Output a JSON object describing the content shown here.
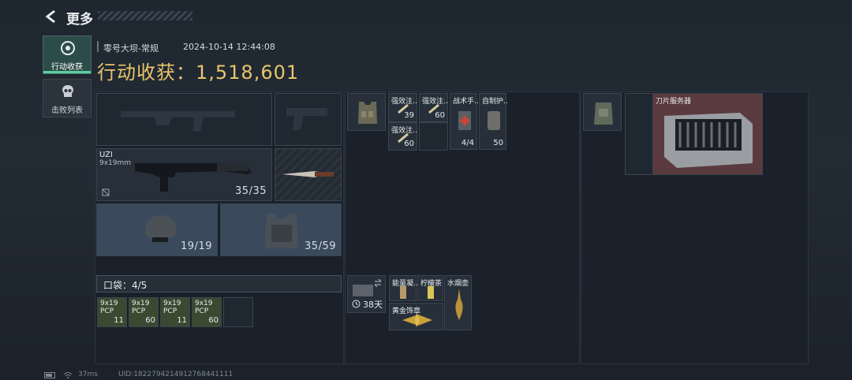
{
  "header": {
    "back_title": "更多"
  },
  "sidebar": {
    "items": [
      {
        "label": "行动收获",
        "icon": "target-icon"
      },
      {
        "label": "击败列表",
        "icon": "skull-icon"
      }
    ]
  },
  "summary": {
    "map": "零号大坝-常规",
    "datetime": "2024-10-14 12:44:08",
    "title": "行动收获：1,518,601"
  },
  "loadout": {
    "sidearm_name": "UZI",
    "sidearm_ammo": "9x19mm",
    "sidearm_durability": "35/35",
    "helmet_durability": "19/19",
    "armor_durability": "35/59"
  },
  "pocket": {
    "label": "口袋：4/5",
    "items": [
      {
        "name": "9x19 PCP",
        "count": "11"
      },
      {
        "name": "9x19 PCP",
        "count": "60"
      },
      {
        "name": "9x19 PCP",
        "count": "11"
      },
      {
        "name": "9x19 PCP",
        "count": "60"
      }
    ]
  },
  "rig": {
    "items": [
      {
        "name": "强效注…",
        "count": "39"
      },
      {
        "name": "强效注…",
        "count": "60"
      },
      {
        "name": "战术手…",
        "count": "4/4"
      },
      {
        "name": "自制护…",
        "count": "50"
      },
      {
        "name": "强效注…",
        "count": "60"
      }
    ]
  },
  "case": {
    "timer": "38天",
    "items": [
      {
        "name": "能量凝…"
      },
      {
        "name": "柠檬茶"
      },
      {
        "name": "水烟壶"
      },
      {
        "name": "黄金饰章"
      }
    ]
  },
  "backpack": {
    "item_name": "刀片服务器"
  },
  "footer": {
    "ping": "37ms",
    "uid": "UID:1822794214912768441111"
  }
}
